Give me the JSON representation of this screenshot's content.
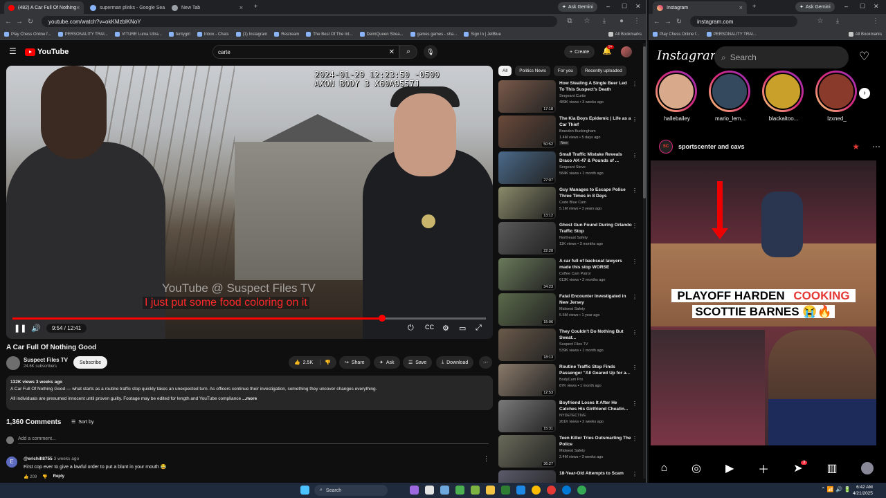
{
  "yt_browser": {
    "tabs": [
      {
        "label": "(482) A Car Full Of Nothing",
        "color": "#ff0000"
      },
      {
        "label": "superman plinks - Google Sea",
        "color": "#8ab4f8"
      },
      {
        "label": "New Tab",
        "color": "#9aa0a6"
      }
    ],
    "ask_gemini": "Ask Gemini",
    "url": "youtube.com/watch?v=okKMzblKNoY",
    "bookmarks": [
      "Play Chess Online f...",
      "PERSONALITY TRAI...",
      "VITURE Luma Ultra...",
      "fentygirl",
      "Inbox - Chats",
      "(1) Instagram",
      "Restream",
      "The Best Of The Int...",
      "DeimQueen Strea...",
      "games games - sha...",
      "Sign In | JetBlue",
      "All Bookmarks"
    ]
  },
  "youtube": {
    "logo_text": "YouTube",
    "search_value": "carte",
    "create_label": "Create",
    "notif_count": "9+",
    "player": {
      "cam_stamp": "2024-01-29 12:23:50 -0500\nAXON BODY 3 X60A9557J",
      "watermark": "YouTube @ Suspect Files TV",
      "caption": "I just put some food coloring on it",
      "time": "9:54 / 12:41",
      "progress": 0.78
    },
    "title": "A Car Full Of Nothing Good",
    "channel": {
      "name": "Suspect Files TV",
      "subs": "24.6K subscribers",
      "subscribe": "Subscribe"
    },
    "actions": {
      "likes": "2.5K",
      "share": "Share",
      "ask": "Ask",
      "save": "Save",
      "download": "Download"
    },
    "description": {
      "meta": "132K views  3 weeks ago",
      "line1": "A Car Full Of Nothing Good — what starts as a routine traffic stop quickly takes an unexpected turn. As officers continue their investigation, something they uncover changes everything.",
      "line2": "All individuals are presumed innocent until proven guilty. Footage may be edited for length and YouTube compliance",
      "more": "...more"
    },
    "comments": {
      "count": "1,360 Comments",
      "sort": "Sort by",
      "add_placeholder": "Add a comment...",
      "first": {
        "initial": "E",
        "author": "@erichill8755",
        "when": "3 weeks ago",
        "text": "First cop ever to give a lawful order to put a blunt in your mouth 😂",
        "likes": "209",
        "reply": "Reply"
      }
    },
    "chips": [
      "All",
      "Politics News",
      "For you",
      "Recently uploaded"
    ],
    "recommendations": [
      {
        "title": "How Stealing A Single Beer Led To This Suspect's Death",
        "channel": "Sergeant Curtis",
        "meta": "489K views • 3 weeks ago",
        "duration": "17:18",
        "thumb": "#7a5a4a",
        "new": ""
      },
      {
        "title": "The Kia Boys Epidemic | Life as a Car Thief",
        "channel": "Brandon Buckingham",
        "meta": "1.4M views • 5 days ago",
        "duration": "50:52",
        "thumb": "#6a4a3a",
        "new": "New"
      },
      {
        "title": "Small Traffic Mistake Reveals Draco AK-47 & Pounds of ...",
        "channel": "Sergeant Steve",
        "meta": "584K views • 1 month ago",
        "duration": "27:07",
        "thumb": "#4a6a8a",
        "new": ""
      },
      {
        "title": "Guy Manages to Escape Police Three Times in 8 Days",
        "channel": "Code Blue Cam",
        "meta": "5.1M views • 3 years ago",
        "duration": "13:12",
        "thumb": "#8a8a6a",
        "new": ""
      },
      {
        "title": "Ghost Gun Found During Orlando Traffic Stop",
        "channel": "Northeast Safety",
        "meta": "11K views • 3 months ago",
        "duration": "22:20",
        "thumb": "#5a5a5a",
        "new": ""
      },
      {
        "title": "A car full of backseat lawyers made this stop WORSE",
        "channel": "Coffee Cam Patrol",
        "meta": "613K views • 2 months ago",
        "duration": "34:23",
        "thumb": "#6a7a5a",
        "new": ""
      },
      {
        "title": "Fatal Encounter Investigated in New Jersey",
        "channel": "Midwest Safety",
        "meta": "5.6M views • 1 year ago",
        "duration": "15:06",
        "thumb": "#5a6a4a",
        "new": ""
      },
      {
        "title": "They Couldn't Do Nothing But Sweat...",
        "channel": "Suspect Files TV",
        "meta": "539K views • 1 month ago",
        "duration": "18:13",
        "thumb": "#6a5a4a",
        "new": ""
      },
      {
        "title": "Routine Traffic Stop Finds Passenger \"All Geared Up for a...",
        "channel": "BodyCam Pro",
        "meta": "87K views • 1 month ago",
        "duration": "12:53",
        "thumb": "#8a7a6a",
        "new": ""
      },
      {
        "title": "Boyfriend Loses It After He Catches His Girlfriend Cheatin...",
        "channel": "NYDETECTIVE",
        "meta": "261K views • 2 weeks ago",
        "duration": "15:31",
        "thumb": "#7a7a7a",
        "new": ""
      },
      {
        "title": "Teen Killer Tries Outsmarting The Police",
        "channel": "Midwest Safety",
        "meta": "2.4M views • 3 weeks ago",
        "duration": "36:27",
        "thumb": "#6a6a5a",
        "new": ""
      },
      {
        "title": "18-Year-Old Attempts to Scam",
        "channel": "",
        "meta": "",
        "duration": "",
        "thumb": "#5a5a6a",
        "new": ""
      }
    ]
  },
  "ig_browser": {
    "tab": "Instagram",
    "ask_gemini": "Ask Gemini",
    "url": "instagram.com",
    "bookmarks": [
      "Play Chess Online f...",
      "PERSONALITY TRAI...",
      "All Bookmarks"
    ]
  },
  "instagram": {
    "logo": "Instagram",
    "search_placeholder": "Search",
    "stories": [
      {
        "name": "hallebailey",
        "color": "#d8a98a"
      },
      {
        "name": "mario_lem...",
        "color": "#34495e"
      },
      {
        "name": "blackaitoo...",
        "color": "#c8a02a"
      },
      {
        "name": "lzxned_",
        "color": "#8a3a2a"
      }
    ],
    "post": {
      "avatar_text": "SC",
      "author": "sportscenter and cavs",
      "headline_1": "PLAYOFF HARDEN",
      "headline_hot": "COOKING",
      "headline_2": "SCOTTIE BARNES 😭🔥"
    },
    "notif_badge": "3"
  },
  "taskbar": {
    "search_label": "Search",
    "time": "6:42 AM",
    "date": "4/21/2025"
  }
}
